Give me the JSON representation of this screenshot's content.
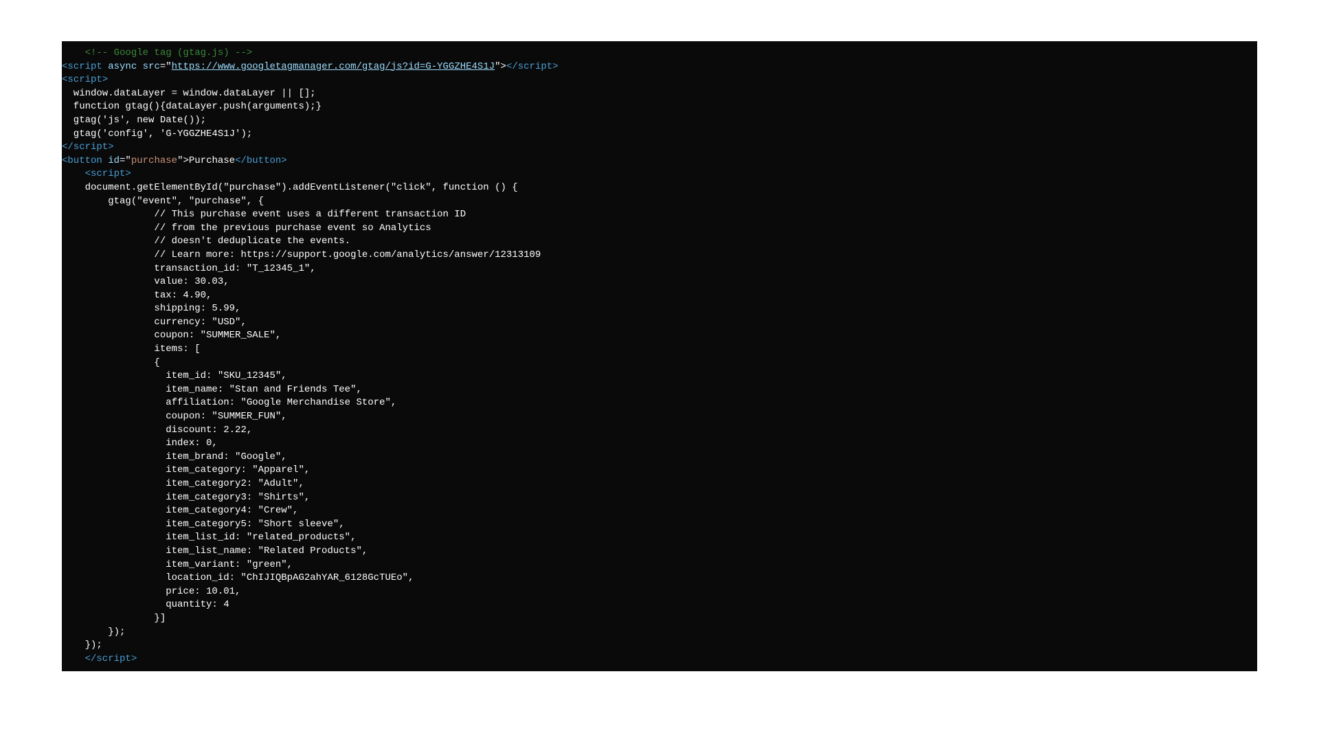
{
  "code": {
    "line01": "    <!-- Google tag (gtag.js) -->",
    "line02_a": "<script",
    "line02_b": " async",
    "line02_c": " src",
    "line02_d": "=\"",
    "line02_url": "https://www.googletagmanager.com/gtag/js?id=G-YGGZHE4S1J",
    "line02_e": "\">",
    "line02_f": "</script>",
    "line03": "<script>",
    "line04": "  window.dataLayer = window.dataLayer || [];",
    "line05": "  function gtag(){dataLayer.push(arguments);}",
    "line06": "  gtag('js', new Date());",
    "line07": "",
    "line08": "  gtag('config', 'G-YGGZHE4S1J');",
    "line09": "</script>",
    "line10_a": "<button",
    "line10_b": " id",
    "line10_c": "=\"",
    "line10_d": "purchase",
    "line10_e": "\">",
    "line10_f": "Purchase",
    "line10_g": "</button>",
    "line11": "    <script>",
    "line12": "    document.getElementById(\"purchase\").addEventListener(\"click\", function () {",
    "line13": "        gtag(\"event\", \"purchase\", {",
    "line14": "                // This purchase event uses a different transaction ID",
    "line15": "                // from the previous purchase event so Analytics",
    "line16": "                // doesn't deduplicate the events.",
    "line17": "                // Learn more: https://support.google.com/analytics/answer/12313109",
    "line18": "                transaction_id: \"T_12345_1\",",
    "line19": "                value: 30.03,",
    "line20": "                tax: 4.90,",
    "line21": "                shipping: 5.99,",
    "line22": "                currency: \"USD\",",
    "line23": "                coupon: \"SUMMER_SALE\",",
    "line24": "                items: [",
    "line25": "                {",
    "line26": "                  item_id: \"SKU_12345\",",
    "line27": "                  item_name: \"Stan and Friends Tee\",",
    "line28": "                  affiliation: \"Google Merchandise Store\",",
    "line29": "                  coupon: \"SUMMER_FUN\",",
    "line30": "                  discount: 2.22,",
    "line31": "                  index: 0,",
    "line32": "                  item_brand: \"Google\",",
    "line33": "                  item_category: \"Apparel\",",
    "line34": "                  item_category2: \"Adult\",",
    "line35": "                  item_category3: \"Shirts\",",
    "line36": "                  item_category4: \"Crew\",",
    "line37": "                  item_category5: \"Short sleeve\",",
    "line38": "                  item_list_id: \"related_products\",",
    "line39": "                  item_list_name: \"Related Products\",",
    "line40": "                  item_variant: \"green\",",
    "line41": "                  location_id: \"ChIJIQBpAG2ahYAR_6128GcTUEo\",",
    "line42": "                  price: 10.01,",
    "line43": "                  quantity: 4",
    "line44": "                }]",
    "line45": "        });",
    "line46": "    });",
    "line47": "    </script>"
  }
}
